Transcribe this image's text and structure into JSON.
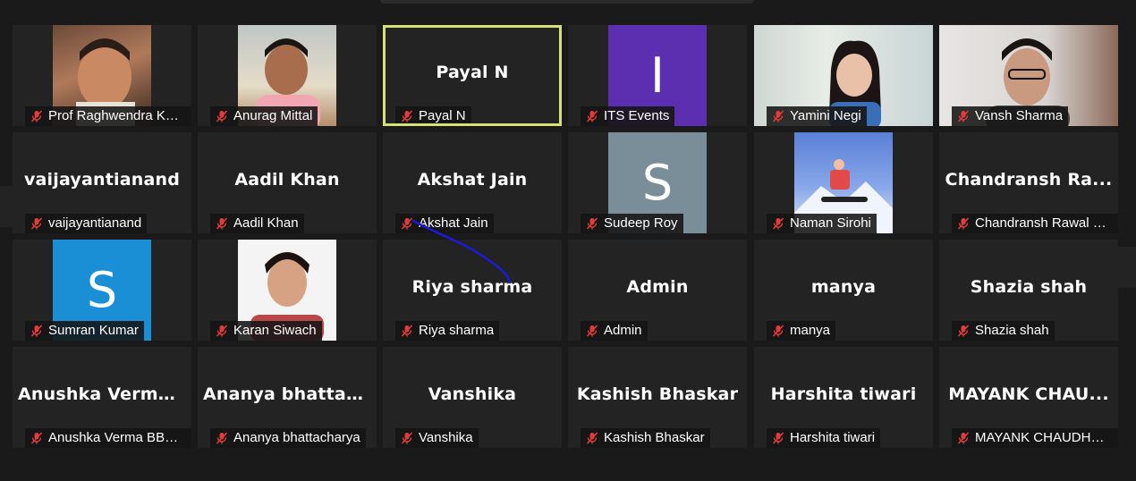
{
  "participants": [
    {
      "big": "",
      "label": "Prof Raghwendra Kum...",
      "kind": "photo1"
    },
    {
      "big": "",
      "label": "Anurag Mittal",
      "kind": "photo2"
    },
    {
      "big": "Payal N",
      "label": "Payal N",
      "kind": "name",
      "active": true
    },
    {
      "big": "I",
      "label": "ITS Events",
      "kind": "avatarI"
    },
    {
      "big": "",
      "label": "Yamini Negi",
      "kind": "photo3"
    },
    {
      "big": "",
      "label": "Vansh Sharma",
      "kind": "photo4"
    },
    {
      "big": "vaijayantianand",
      "label": "vaijayantianand",
      "kind": "name"
    },
    {
      "big": "Aadil Khan",
      "label": "Aadil Khan",
      "kind": "name"
    },
    {
      "big": "Akshat Jain",
      "label": "Akshat Jain",
      "kind": "name"
    },
    {
      "big": "S",
      "label": "Sudeep Roy",
      "kind": "avatarS"
    },
    {
      "big": "",
      "label": "Naman Sirohi",
      "kind": "photo5"
    },
    {
      "big": "Chandransh  Ra...",
      "label": "Chandransh Rawal BB...",
      "kind": "name"
    },
    {
      "big": "S",
      "label": "Sumran Kumar",
      "kind": "avatarBlue"
    },
    {
      "big": "",
      "label": "Karan Siwach",
      "kind": "photo6"
    },
    {
      "big": "Riya sharma",
      "label": "Riya sharma",
      "kind": "name"
    },
    {
      "big": "Admin",
      "label": "Admin",
      "kind": "name"
    },
    {
      "big": "manya",
      "label": "manya",
      "kind": "name"
    },
    {
      "big": "Shazia shah",
      "label": "Shazia shah",
      "kind": "name"
    },
    {
      "big": "Anushka  Verma...",
      "label": "Anushka Verma BBA s...",
      "kind": "name"
    },
    {
      "big": "Ananya  bhattac...",
      "label": "Ananya bhattacharya",
      "kind": "name"
    },
    {
      "big": "Vanshika",
      "label": "Vanshika",
      "kind": "name"
    },
    {
      "big": "Kashish Bhaskar",
      "label": "Kashish Bhaskar",
      "kind": "name"
    },
    {
      "big": "Harshita tiwari",
      "label": "Harshita tiwari",
      "kind": "name"
    },
    {
      "big": "MAYANK  CHAU...",
      "label": "MAYANK CHAUDHARY",
      "kind": "name"
    }
  ],
  "colors": {
    "active_border": "#d6e07a",
    "avatar_purple": "#5b2fb0",
    "avatar_gray": "#7a8e9a",
    "avatar_blue": "#1a8fd6",
    "muted_mic": "#e23b3b",
    "annotation": "#1a1ad8"
  },
  "icons": {
    "muted": "mic-muted-icon"
  }
}
